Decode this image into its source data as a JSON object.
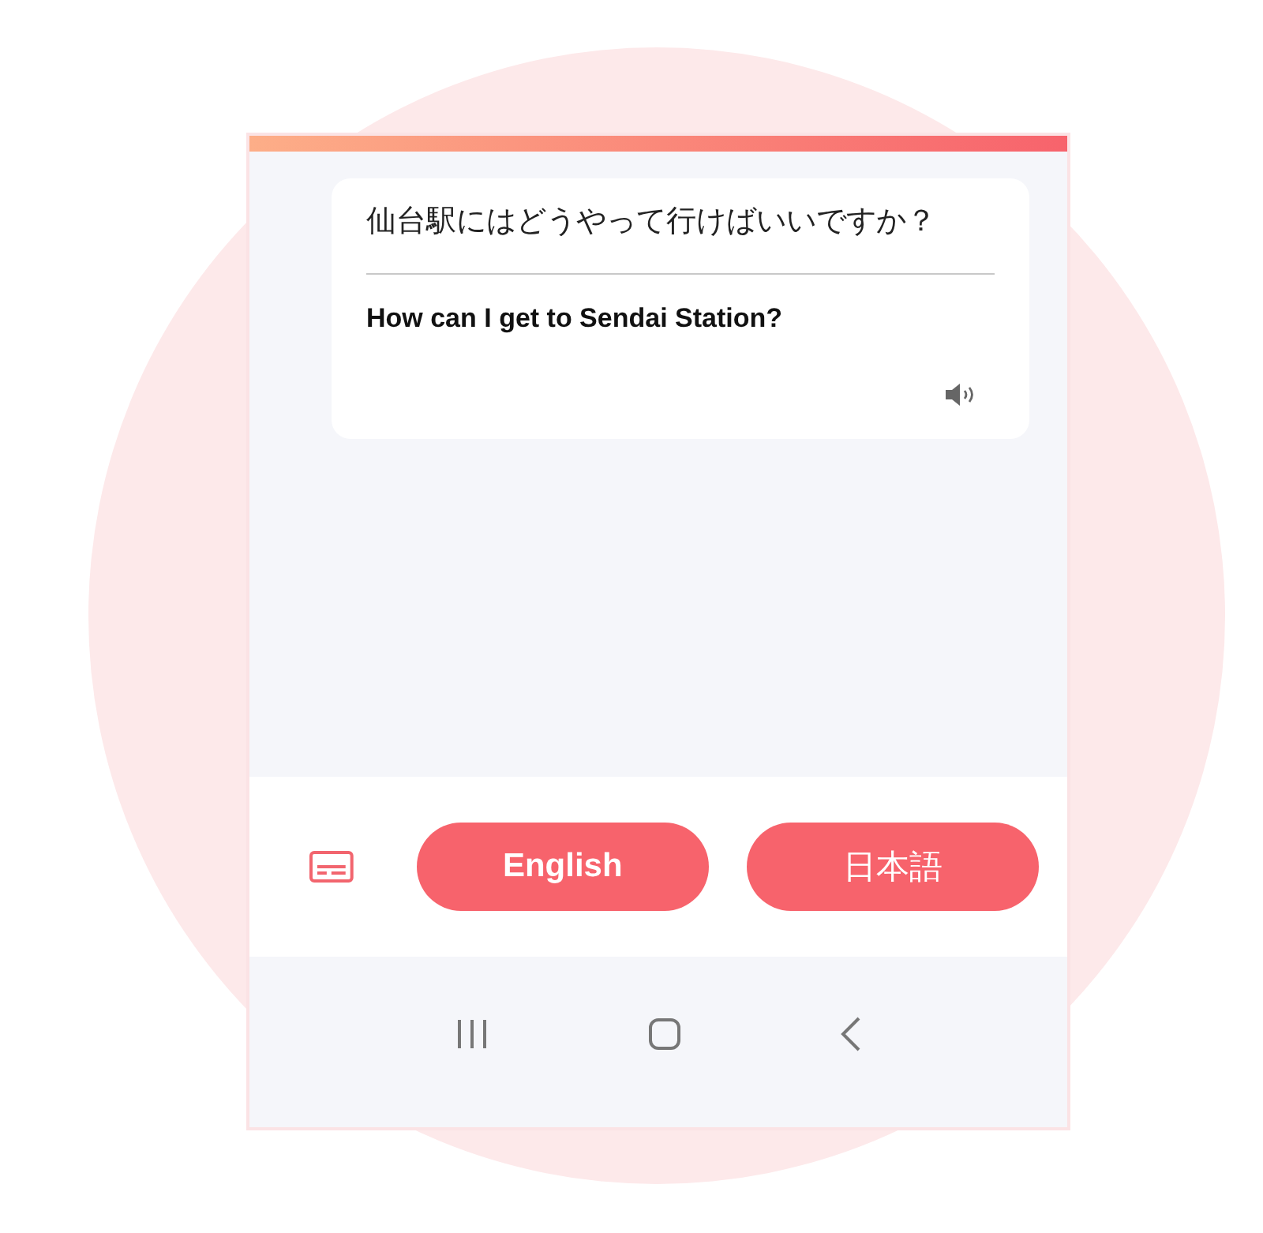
{
  "message": {
    "source_text": "仙台駅にはどうやって行けばいいですか？",
    "translation": "How can I get to Sendai Station?"
  },
  "language_buttons": [
    {
      "label": "English"
    },
    {
      "label": "日本語"
    }
  ]
}
